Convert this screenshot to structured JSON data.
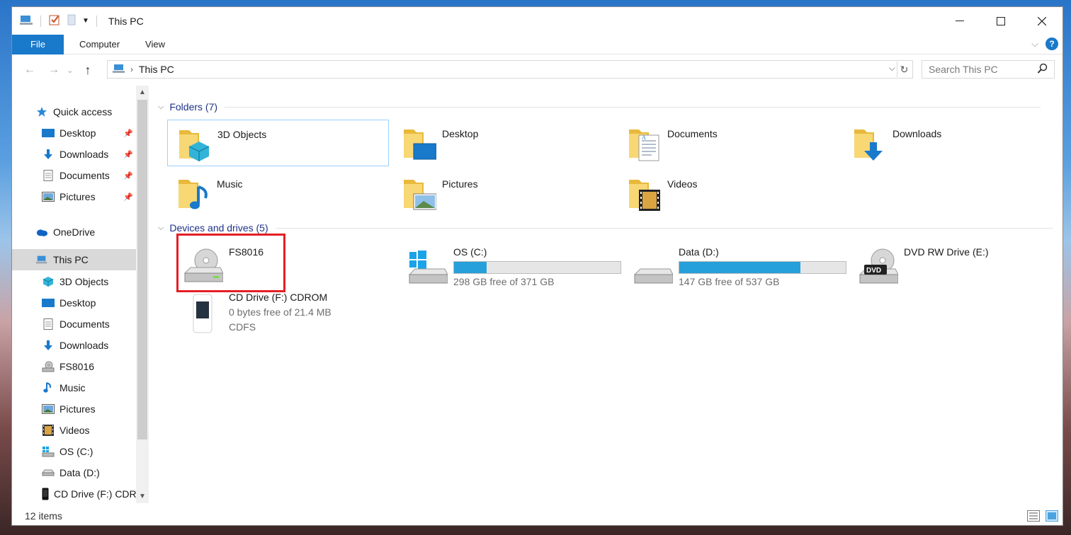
{
  "window": {
    "title": "This PC"
  },
  "ribbon": {
    "tabs": [
      "File",
      "Computer",
      "View"
    ],
    "help": "?"
  },
  "nav": {
    "crumb": "This PC",
    "search_placeholder": "Search This PC"
  },
  "sidebar": {
    "items": [
      {
        "label": "Quick access",
        "icon": "star-icon",
        "pinned": false
      },
      {
        "label": "Desktop",
        "icon": "desktop-icon",
        "pinned": true
      },
      {
        "label": "Downloads",
        "icon": "download-icon",
        "pinned": true
      },
      {
        "label": "Documents",
        "icon": "document-icon",
        "pinned": true
      },
      {
        "label": "Pictures",
        "icon": "pictures-icon",
        "pinned": true
      },
      {
        "label": "OneDrive",
        "icon": "cloud-icon",
        "pinned": false
      },
      {
        "label": "This PC",
        "icon": "computer-icon",
        "pinned": false,
        "selected": true
      },
      {
        "label": "3D Objects",
        "icon": "cube-icon",
        "pinned": false
      },
      {
        "label": "Desktop",
        "icon": "desktop-icon",
        "pinned": false
      },
      {
        "label": "Documents",
        "icon": "document-icon",
        "pinned": false
      },
      {
        "label": "Downloads",
        "icon": "download-icon",
        "pinned": false
      },
      {
        "label": "FS8016",
        "icon": "disc-drive-icon",
        "pinned": false
      },
      {
        "label": "Music",
        "icon": "music-note-icon",
        "pinned": false
      },
      {
        "label": "Pictures",
        "icon": "pictures-icon",
        "pinned": false
      },
      {
        "label": "Videos",
        "icon": "film-icon",
        "pinned": false
      },
      {
        "label": "OS (C:)",
        "icon": "windows-drive-icon",
        "pinned": false
      },
      {
        "label": "Data (D:)",
        "icon": "hard-drive-icon",
        "pinned": false
      },
      {
        "label": "CD Drive (F:) CDROM",
        "icon": "phone-drive-icon",
        "pinned": false
      }
    ]
  },
  "folders": {
    "header": "Folders (7)",
    "items": [
      "3D Objects",
      "Desktop",
      "Documents",
      "Downloads",
      "Music",
      "Pictures",
      "Videos"
    ]
  },
  "drives": {
    "header": "Devices and drives (5)",
    "items": [
      {
        "name": "FS8016",
        "icon": "disc-drive-icon"
      },
      {
        "name": "OS (C:)",
        "free": "298 GB free of 371 GB",
        "used_fraction": 0.197,
        "icon": "windows-drive-icon"
      },
      {
        "name": "Data (D:)",
        "free": "147 GB free of 537 GB",
        "used_fraction": 0.726,
        "icon": "hard-drive-icon"
      },
      {
        "name": "DVD RW Drive (E:)",
        "icon": "dvd-drive-icon"
      },
      {
        "name": "CD Drive (F:) CDROM",
        "free": "0 bytes free of 21.4 MB",
        "fs": "CDFS",
        "icon": "phone-drive-icon"
      }
    ]
  },
  "status": {
    "count": "12 items"
  },
  "colors": {
    "accent": "#1979ca",
    "bar_fill": "#26a0da",
    "highlight": "#e41f26"
  }
}
